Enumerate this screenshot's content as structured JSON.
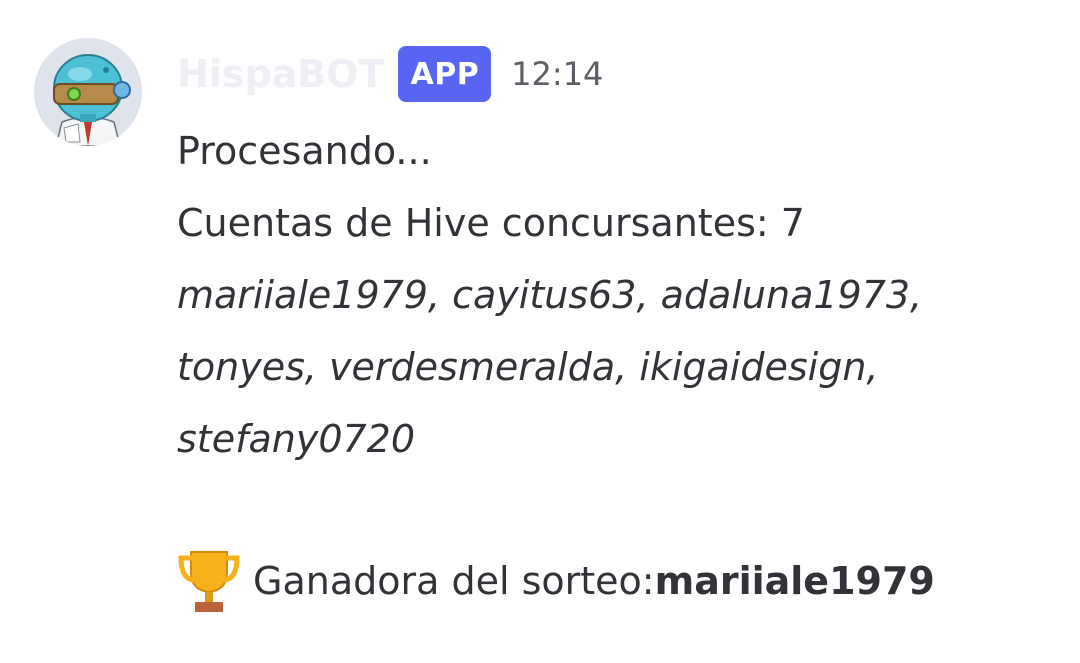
{
  "message": {
    "username": "HispaBOT",
    "badge": "APP",
    "timestamp": "12:14",
    "status_line": "Procesando...",
    "accounts_label": "Cuentas de Hive concursantes: 7",
    "accounts_list": "mariiale1979, cayitus63, adaluna1973, tonyes, verdesmeralda, ikigaidesign, stefany0720",
    "winner_label": "Ganadora del sorteo: ",
    "winner_name": "mariiale1979",
    "icons": {
      "winner": "trophy-icon",
      "avatar": "robot-avatar"
    }
  },
  "colors": {
    "badge": "#5865f2",
    "text": "#313338",
    "timestamp": "#5c5e66",
    "username": "#eef0f6"
  }
}
